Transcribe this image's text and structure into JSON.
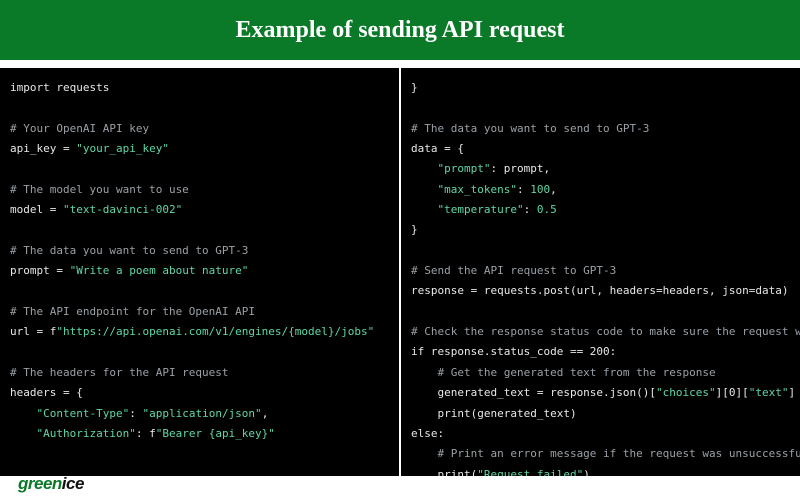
{
  "header": {
    "title": "Example of sending API request"
  },
  "code": {
    "left": {
      "l01_import": "import requests",
      "l02_blank": "",
      "l03_cmt": "# Your OpenAI API key",
      "l04_a": "api_key = ",
      "l04_b": "\"your_api_key\"",
      "l05_blank": "",
      "l06_cmt": "# The model you want to use",
      "l07_a": "model = ",
      "l07_b": "\"text-davinci-002\"",
      "l08_blank": "",
      "l09_cmt": "# The data you want to send to GPT-3",
      "l10_a": "prompt = ",
      "l10_b": "\"Write a poem about nature\"",
      "l11_blank": "",
      "l12_cmt": "# The API endpoint for the OpenAI API",
      "l13_a": "url = f",
      "l13_b": "\"https://api.openai.com/v1/engines/{model}/jobs\"",
      "l14_blank": "",
      "l15_cmt": "# The headers for the API request",
      "l16": "headers = {",
      "l17_a": "    \"Content-Type\"",
      "l17_b": ": ",
      "l17_c": "\"application/json\"",
      "l17_d": ",",
      "l18_a": "    \"Authorization\"",
      "l18_b": ": f",
      "l18_c": "\"Bearer {api_key}\""
    },
    "right": {
      "r01": "}",
      "r02_blank": "",
      "r03_cmt": "# The data you want to send to GPT-3",
      "r04": "data = {",
      "r05_a": "    \"prompt\"",
      "r05_b": ": prompt,",
      "r06_a": "    \"max_tokens\"",
      "r06_b": ": ",
      "r06_c": "100",
      "r06_d": ",",
      "r07_a": "    \"temperature\"",
      "r07_b": ": ",
      "r07_c": "0.5",
      "r08": "}",
      "r09_blank": "",
      "r10_cmt": "# Send the API request to GPT-3",
      "r11": "response = requests.post(url, headers=headers, json=data)",
      "r12_blank": "",
      "r13_cmt": "# Check the response status code to make sure the request was successful",
      "r14": "if response.status_code == 200:",
      "r15_cmt": "    # Get the generated text from the response",
      "r16_a": "    generated_text = response.json()[",
      "r16_b": "\"choices\"",
      "r16_c": "][0][",
      "r16_d": "\"text\"",
      "r16_e": "]",
      "r17": "    print(generated_text)",
      "r18": "else:",
      "r19_cmt": "    # Print an error message if the request was unsuccessful",
      "r20_a": "    print(",
      "r20_b": "\"Request failed\"",
      "r20_c": ")"
    }
  },
  "footer": {
    "g": "green",
    "rest": "ice"
  }
}
